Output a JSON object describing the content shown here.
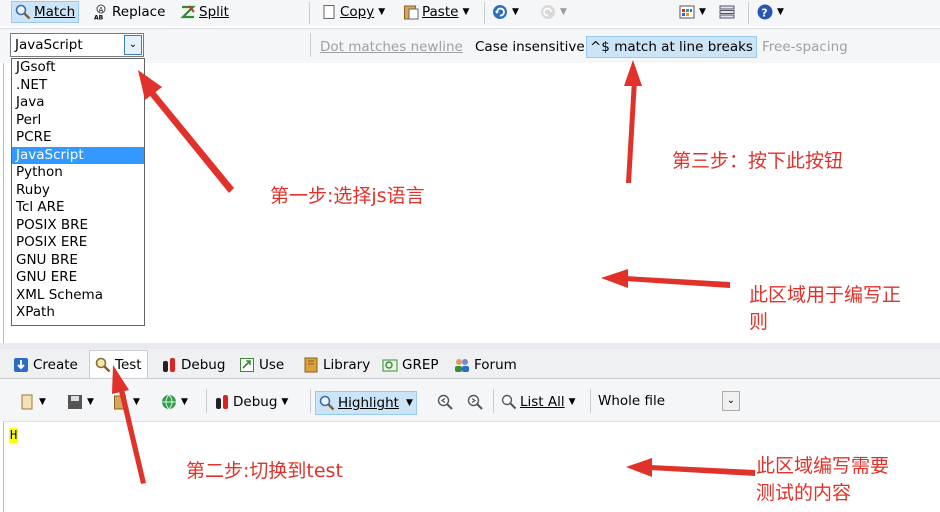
{
  "toolbar1": {
    "match": "Match",
    "replace": "Replace",
    "split": "Split",
    "copy": "Copy",
    "paste": "Paste"
  },
  "options": {
    "language_selected": "JavaScript",
    "dot_matches_newline": "Dot matches newline",
    "case_insensitive": "Case insensitive",
    "match_line_breaks": "^$ match at line breaks",
    "free_spacing": "Free-spacing"
  },
  "languages": [
    "JGsoft",
    ".NET",
    "Java",
    "Perl",
    "PCRE",
    "JavaScript",
    "Python",
    "Ruby",
    "Tcl ARE",
    "POSIX BRE",
    "POSIX ERE",
    "GNU BRE",
    "GNU ERE",
    "XML Schema",
    "XPath"
  ],
  "tabs": [
    "Create",
    "Test",
    "Debug",
    "Use",
    "Library",
    "GREP",
    "Forum"
  ],
  "toolbar2": {
    "debug": "Debug",
    "highlight": "Highlight",
    "list_all": "List All",
    "whole_file": "Whole file"
  },
  "test_text": "H",
  "annotations": {
    "step1": "第一步:选择js语言",
    "step2": "第二步:切换到test",
    "step3": "第三步：按下此按钮",
    "regex_area_line1": "此区域用于编写正",
    "regex_area_line2": "则",
    "test_area_line1": "此区域编写需要",
    "test_area_line2": "测试的内容"
  },
  "colors": {
    "annotation": "#e0322a",
    "active_button": "#cce4f7",
    "selected_item": "#3399ff",
    "highlight_match": "#ffff00"
  }
}
